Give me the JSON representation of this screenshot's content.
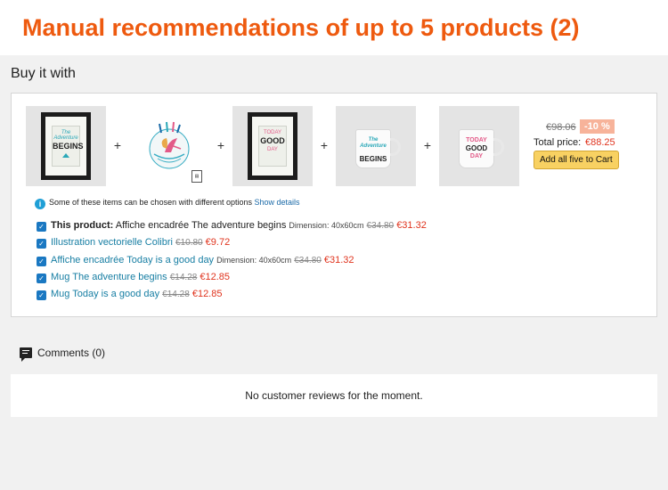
{
  "banner": {
    "title": "Manual recommendations of up to 5 products (2)"
  },
  "section": {
    "title": "Buy it with"
  },
  "bundle": {
    "thumbs": {
      "poster1": {
        "l1": "The Adventure",
        "l2": "BEGINS"
      },
      "poster2": {
        "l1": "TODAY",
        "l2": "GOOD",
        "l3": "DAY"
      },
      "mug1": {
        "l1": "The Adventure",
        "l2": "BEGINS"
      },
      "mug2": {
        "l1": "TODAY",
        "l2": "GOOD",
        "l3": "DAY"
      }
    },
    "plus": "+",
    "old_total": "€98.06",
    "discount": "-10 %",
    "total_label": "Total price:",
    "total_value": "€88.25",
    "cart_button": "Add all five to Cart",
    "options_note": "Some of these items can be chosen with different options",
    "show_details": "Show details",
    "items": [
      {
        "prefix": "This product:",
        "name": "Affiche encadrée The adventure begins",
        "dimension": "Dimension: 40x60cm",
        "old_price": "€34.80",
        "new_price": "€31.32"
      },
      {
        "name": "Illustration vectorielle Colibri",
        "old_price": "€10.80",
        "new_price": "€9.72"
      },
      {
        "name": "Affiche encadrée Today is a good day",
        "dimension": "Dimension: 40x60cm",
        "old_price": "€34.80",
        "new_price": "€31.32"
      },
      {
        "name": "Mug The adventure begins",
        "old_price": "€14.28",
        "new_price": "€12.85"
      },
      {
        "name": "Mug Today is a good day",
        "old_price": "€14.28",
        "new_price": "€12.85"
      }
    ]
  },
  "comments": {
    "title": "Comments (0)",
    "empty": "No customer reviews for the moment."
  },
  "colors": {
    "brand": "#ee5a0f",
    "price": "#e0341e",
    "link": "#177ea3",
    "button": "#f8d162",
    "checkbox": "#1a78c2"
  },
  "icons": [
    "info-icon",
    "checkbox-checked-icon",
    "comment-icon",
    "file-icon"
  ]
}
